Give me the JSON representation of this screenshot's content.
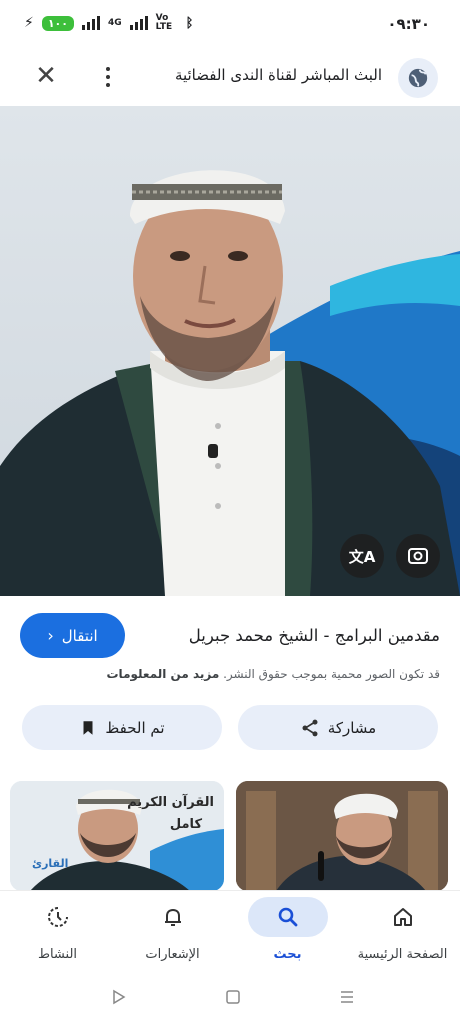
{
  "status_bar": {
    "time": "٠٩:٣٠",
    "battery": "١٠٠",
    "net_4g": "4G",
    "volte": "Vo LTE"
  },
  "header": {
    "title": "البث المباشر لقناة الندى الفضائية",
    "site_icon": "globe-icon",
    "menu_icon": "more-vert-icon",
    "close_icon": "close-icon"
  },
  "hero": {
    "translate_icon": "translate-icon",
    "lens_icon": "lens-icon"
  },
  "result": {
    "title": "مقدمين البرامج - الشيخ محمد جبريل",
    "go_label": "انتقال",
    "copyright_text": "قد تكون الصور محمية بموجب حقوق النشر.",
    "more_info": "مزيد من المعلومات"
  },
  "actions": {
    "share_label": "مشاركة",
    "save_label": "تم الحفظ"
  },
  "thumbs": {
    "left_caption_1": "القرآن الكريم",
    "left_caption_2": "كامل",
    "left_caption_3": "القارئ"
  },
  "bottom_nav": [
    {
      "label": "الصفحة الرئيسية",
      "icon": "home-icon"
    },
    {
      "label": "بحث",
      "icon": "search-icon",
      "active": true
    },
    {
      "label": "الإشعارات",
      "icon": "bell-icon"
    },
    {
      "label": "النشاط",
      "icon": "activity-icon"
    }
  ],
  "colors": {
    "accent": "#1b6fe0",
    "pill_bg": "#e8eef9"
  }
}
